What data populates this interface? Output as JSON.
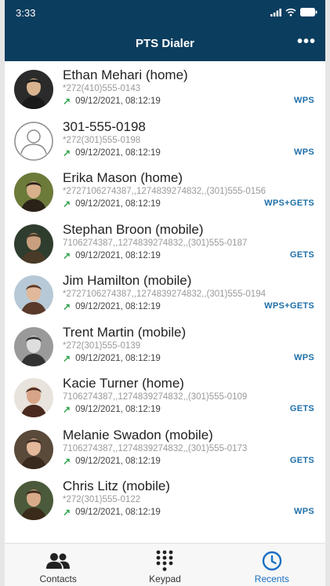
{
  "status_bar": {
    "time": "3:33",
    "icons": [
      "signal-icon",
      "wifi-icon",
      "battery-icon"
    ]
  },
  "header": {
    "title": "PTS Dialer",
    "menu_icon": "more-horizontal-icon",
    "menu_label": "•••"
  },
  "colors": {
    "header_bg": "#0b3d5e",
    "accent": "#1b6fc2",
    "outgoing_arrow": "#2ea34a",
    "badge": "#1d6fa8"
  },
  "recents": [
    {
      "name": "Ethan Mehari (home)",
      "number": "*272(410)555-0143",
      "direction_icon": "outgoing-call-arrow-icon",
      "arrow": "↗",
      "datetime": "09/12/2021, 08:12:19",
      "badge": "WPS",
      "avatar": "photo"
    },
    {
      "name": "301-555-0198",
      "number": "*272(301)555-0198",
      "direction_icon": "outgoing-call-arrow-icon",
      "arrow": "↗",
      "datetime": "09/12/2021, 08:12:19",
      "badge": "WPS",
      "avatar": "placeholder"
    },
    {
      "name": "Erika Mason (home)",
      "number": "*2727106274387,,1274839274832,,(301)555-0156",
      "direction_icon": "outgoing-call-arrow-icon",
      "arrow": "↗",
      "datetime": "09/12/2021, 08:12:19",
      "badge": "WPS+GETS",
      "avatar": "photo"
    },
    {
      "name": "Stephan Broon (mobile)",
      "number": "7106274387,,1274839274832,,(301)555-0187",
      "direction_icon": "outgoing-call-arrow-icon",
      "arrow": "↗",
      "datetime": "09/12/2021, 08:12:19",
      "badge": "GETS",
      "avatar": "photo"
    },
    {
      "name": "Jim Hamilton (mobile)",
      "number": "*2727106274387,,1274839274832,,(301)555-0194",
      "direction_icon": "outgoing-call-arrow-icon",
      "arrow": "↗",
      "datetime": "09/12/2021, 08:12:19",
      "badge": "WPS+GETS",
      "avatar": "photo"
    },
    {
      "name": "Trent Martin (mobile)",
      "number": "*272(301)555-0139",
      "direction_icon": "outgoing-call-arrow-icon",
      "arrow": "↗",
      "datetime": "09/12/2021, 08:12:19",
      "badge": "WPS",
      "avatar": "photo"
    },
    {
      "name": "Kacie Turner (home)",
      "number": "7106274387,,1274839274832,,(301)555-0109",
      "direction_icon": "outgoing-call-arrow-icon",
      "arrow": "↗",
      "datetime": "09/12/2021, 08:12:19",
      "badge": "GETS",
      "avatar": "photo"
    },
    {
      "name": "Melanie Swadon (mobile)",
      "number": "7106274387,,1274839274832,,(301)555-0173",
      "direction_icon": "outgoing-call-arrow-icon",
      "arrow": "↗",
      "datetime": "09/12/2021, 08:12:19",
      "badge": "GETS",
      "avatar": "photo"
    },
    {
      "name": "Chris Litz (mobile)",
      "number": "*272(301)555-0122",
      "direction_icon": "outgoing-call-arrow-icon",
      "arrow": "↗",
      "datetime": "09/12/2021, 08:12:19",
      "badge": "WPS",
      "avatar": "photo"
    }
  ],
  "tabs": [
    {
      "label": "Contacts",
      "icon": "contacts-icon",
      "active": false
    },
    {
      "label": "Keypad",
      "icon": "keypad-icon",
      "active": false
    },
    {
      "label": "Recents",
      "icon": "clock-icon",
      "active": true
    }
  ]
}
